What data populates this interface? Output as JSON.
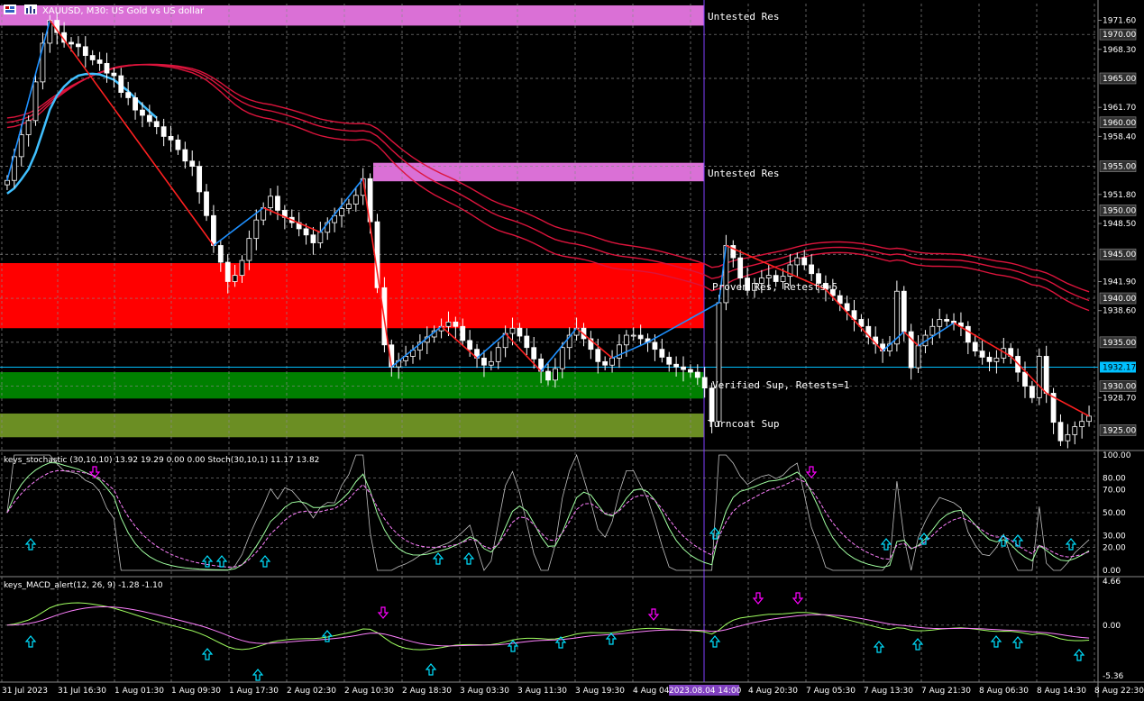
{
  "header": {
    "symbol": "XAUUSD",
    "timeframe": "M30",
    "description": "US Gold vs US dollar",
    "title": "XAUUSD, M30:  US Gold vs US dollar"
  },
  "price_axis": {
    "ticks": [
      "1971.60",
      "1968.30",
      "1961.70",
      "1958.40",
      "1951.80",
      "1948.50",
      "1941.90",
      "1938.60",
      "1928.70"
    ],
    "boxed_levels": [
      "1970.00",
      "1965.00",
      "1960.00",
      "1955.00",
      "1950.00",
      "1945.00",
      "1940.00",
      "1935.00",
      "1930.00",
      "1925.00"
    ],
    "current_price": "1932.17"
  },
  "zones": [
    {
      "label": "Untested Res",
      "color": "#da70d6"
    },
    {
      "label": "Untested Res",
      "color": "#da70d6"
    },
    {
      "label": "Proven Res, Retests=5",
      "color": "#ff0000"
    },
    {
      "label": "Verified Sup, Retests=1",
      "color": "#008000"
    },
    {
      "label": "Turncoat Sup",
      "color": "#6b8e23"
    }
  ],
  "stoch_panel": {
    "title": "keys_stochastic (30,10,10) 13.92 19.29 0.00 0.00 Stoch(30,10,1) 11.17 13.82",
    "ticks": [
      "100.00",
      "80.00",
      "70.00",
      "50.00",
      "30.00",
      "20.00",
      "0.00"
    ]
  },
  "macd_panel": {
    "title": "keys_MACD_alert(12, 26, 9) -1.28 -1.10",
    "ticks": [
      "4.66",
      "0.00",
      "-5.36"
    ]
  },
  "time_axis": {
    "labels": [
      "31 Jul 2023",
      "31 Jul 16:30",
      "1 Aug 01:30",
      "1 Aug 09:30",
      "1 Aug 17:30",
      "2 Aug 02:30",
      "2 Aug 10:30",
      "2 Aug 18:30",
      "3 Aug 03:30",
      "3 Aug 11:30",
      "3 Aug 19:30",
      "4 Aug 04:",
      "2023.08.04 14:00",
      "4 Aug 20:30",
      "7 Aug 05:30",
      "7 Aug 13:30",
      "7 Aug 21:30",
      "8 Aug 06:30",
      "8 Aug 14:30",
      "8 Aug 22:30"
    ]
  },
  "colors": {
    "background": "#000000",
    "bull_candle": "#ffffff",
    "bear_candle": "#ffffff",
    "zigzag_up": "#1e90ff",
    "zigzag_down": "#ff2020",
    "ma": "#dc143c",
    "ma_fast": "#40c0ff",
    "grid": "#8a8a8a",
    "crosshair": "#8040ff",
    "current_price_line": "#00c0ff",
    "arrow_up": "#00e0ff",
    "arrow_down": "#ff00ff",
    "stoch_main": "#a0ffa0",
    "stoch_signal": "#ff80ff",
    "stoch_raw": "#c0c0c0",
    "macd_main": "#a0ff60",
    "macd_signal": "#ff80ff"
  },
  "chart_data": {
    "type": "candlestick",
    "price_range": [
      1923.0,
      1973.5
    ],
    "close": [
      1953.4,
      1956.1,
      1958.6,
      1960.2,
      1964.6,
      1969.0,
      1971.6,
      1970.2,
      1969.1,
      1968.9,
      1968.6,
      1967.6,
      1967.1,
      1966.7,
      1965.6,
      1965.3,
      1963.4,
      1962.8,
      1961.4,
      1960.8,
      1960.1,
      1959.5,
      1958.4,
      1958.0,
      1956.9,
      1955.6,
      1955.0,
      1952.1,
      1949.4,
      1946.0,
      1944.1,
      1941.9,
      1942.6,
      1944.3,
      1946.8,
      1948.9,
      1950.3,
      1951.6,
      1950.0,
      1949.2,
      1948.6,
      1947.9,
      1947.2,
      1946.3,
      1947.5,
      1948.6,
      1949.4,
      1950.2,
      1950.7,
      1951.7,
      1953.6,
      1948.7,
      1941.2,
      1934.7,
      1932.2,
      1932.9,
      1933.4,
      1934.1,
      1935.0,
      1935.6,
      1936.3,
      1936.8,
      1937.3,
      1936.8,
      1935.2,
      1934.2,
      1933.2,
      1932.4,
      1932.8,
      1934.4,
      1936.0,
      1936.6,
      1935.7,
      1934.4,
      1933.1,
      1931.7,
      1930.7,
      1932.0,
      1934.4,
      1935.8,
      1936.6,
      1935.4,
      1934.2,
      1932.8,
      1932.4,
      1933.2,
      1934.7,
      1935.8,
      1935.8,
      1935.4,
      1935.0,
      1934.2,
      1933.3,
      1932.5,
      1932.2,
      1931.9,
      1931.6,
      1931.0,
      1929.8,
      1926.0,
      1939.5,
      1946.0,
      1944.6,
      1942.3,
      1940.9,
      1941.7,
      1942.3,
      1942.6,
      1941.9,
      1942.5,
      1943.8,
      1944.6,
      1943.8,
      1942.8,
      1941.7,
      1941.0,
      1940.3,
      1939.4,
      1938.6,
      1937.6,
      1936.8,
      1935.6,
      1934.8,
      1934.0,
      1934.8,
      1940.8,
      1936.2,
      1932.1,
      1934.6,
      1935.8,
      1936.8,
      1937.6,
      1937.4,
      1937.2,
      1936.8,
      1935.0,
      1934.0,
      1933.3,
      1932.8,
      1933.2,
      1934.3,
      1933.4,
      1931.6,
      1930.0,
      1928.7,
      1933.4,
      1929.2,
      1925.9,
      1923.8,
      1924.5,
      1925.4,
      1926.0,
      1926.6
    ]
  }
}
